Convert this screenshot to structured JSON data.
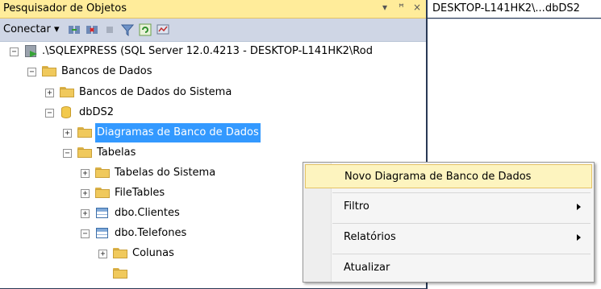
{
  "object_explorer": {
    "title": "Pesquisador de Objetos",
    "title_controls": [
      "▾",
      "ꟸ",
      "×"
    ],
    "toolbar": {
      "connect_label": "Conectar ▾",
      "icons": [
        "connect-object-explorer-icon",
        "disconnect-icon",
        "stop-icon",
        "filter-icon",
        "refresh-icon",
        "activity-monitor-icon"
      ]
    },
    "tree": {
      "server": ".\\SQLEXPRESS (SQL Server 12.0.4213 - DESKTOP-L141HK2\\Rod",
      "databases": "Bancos de Dados",
      "system_databases": "Bancos de Dados do Sistema",
      "db": "dbDS2",
      "diagrams": "Diagramas de Banco de Dados",
      "tables": "Tabelas",
      "system_tables": "Tabelas do Sistema",
      "filetables": "FileTables",
      "t_clientes": "dbo.Clientes",
      "t_telefones": "dbo.Telefones",
      "columns": "Colunas"
    },
    "expanders": {
      "plus": "+",
      "minus": "−"
    }
  },
  "document_tab": {
    "title": "DESKTOP-L141HK2\\...dbDS2"
  },
  "context_menu": {
    "items": [
      {
        "label": "Novo Diagrama de Banco de Dados",
        "highlighted": true
      },
      {
        "label": "Filtro",
        "submenu": true
      },
      {
        "label": "Relatórios",
        "submenu": true
      },
      {
        "label": "Atualizar"
      }
    ]
  },
  "colors": {
    "title_bar": "#ffec9a",
    "toolbar": "#cfd6e5",
    "selection": "#3399ff",
    "menu_highlight": "#fdf4bf",
    "frame": "#293955"
  }
}
